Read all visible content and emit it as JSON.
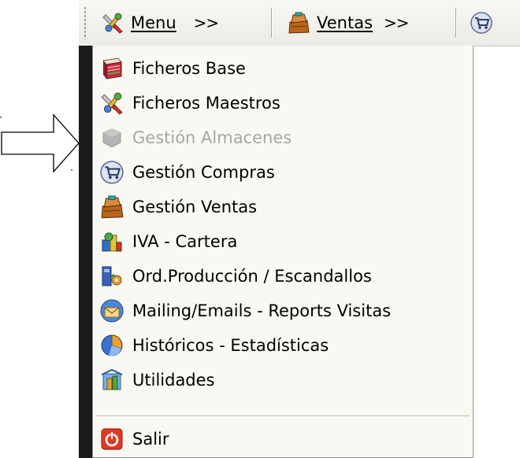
{
  "toolbar": {
    "items": [
      {
        "label": "Menu",
        "chevron": ">>",
        "icon": "tools-menu-icon"
      },
      {
        "label": "Ventas",
        "chevron": ">>",
        "icon": "cash-register-icon"
      },
      {
        "label": "",
        "icon": "shopping-cart-icon"
      }
    ]
  },
  "menu": {
    "items": [
      {
        "label": "Ficheros Base",
        "icon": "book-icon",
        "enabled": true
      },
      {
        "label": "Ficheros Maestros",
        "icon": "tools-icon",
        "enabled": true
      },
      {
        "label": "Gestión Almacenes",
        "icon": "warehouse-icon",
        "enabled": false
      },
      {
        "label": "Gestión Compras",
        "icon": "shopping-cart-icon",
        "enabled": true
      },
      {
        "label": "Gestión Ventas",
        "icon": "cash-register-icon",
        "enabled": true
      },
      {
        "label": "IVA - Cartera",
        "icon": "tax-icon",
        "enabled": true
      },
      {
        "label": "Ord.Producción / Escandallos",
        "icon": "production-icon",
        "enabled": true
      },
      {
        "label": "Mailing/Emails - Reports Visitas",
        "icon": "mail-icon",
        "enabled": true
      },
      {
        "label": "Históricos - Estadísticas",
        "icon": "statistics-icon",
        "enabled": true
      },
      {
        "label": "Utilidades",
        "icon": "utilities-icon",
        "enabled": true
      }
    ],
    "exit": {
      "label": "Salir",
      "icon": "exit-icon"
    }
  },
  "colors": {
    "menu_background": "#f9f8f3",
    "disabled_text": "#a6a6a6",
    "exit_red": "#e03a24"
  }
}
